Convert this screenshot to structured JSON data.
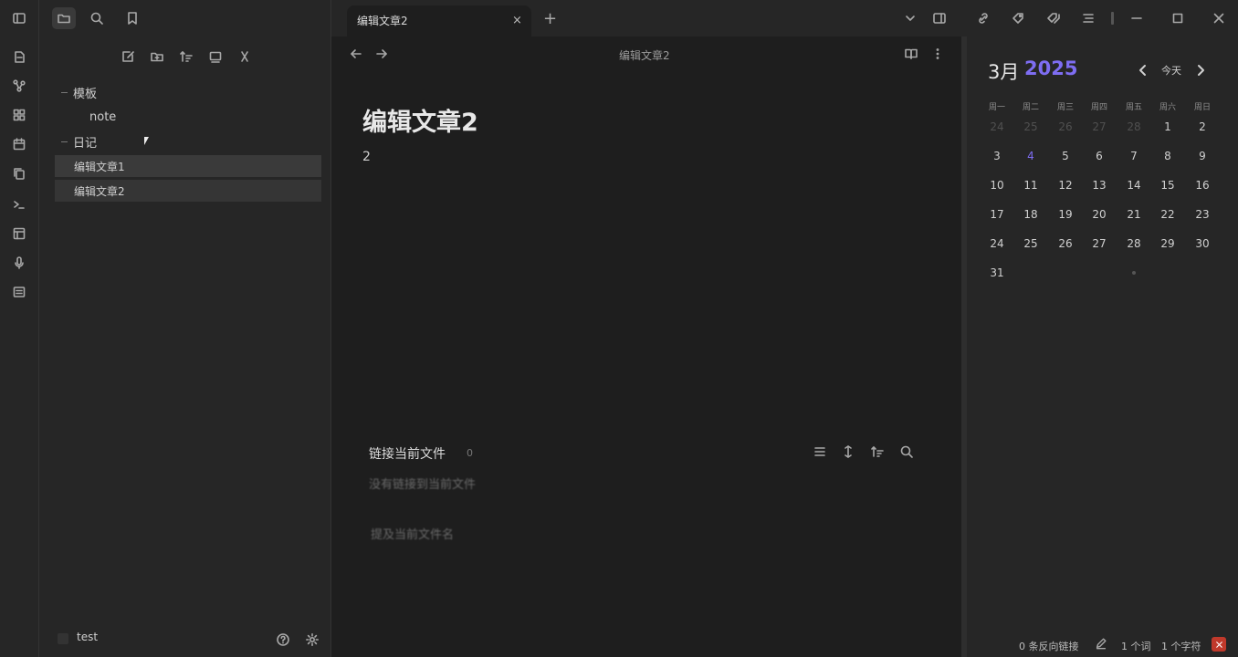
{
  "tab": {
    "title": "编辑文章2",
    "close": "×",
    "add": "+"
  },
  "file_explorer": {
    "folders": [
      {
        "name": "模板",
        "children": [
          "note"
        ]
      },
      {
        "name": "日记",
        "children": []
      }
    ],
    "files": [
      "编辑文章1",
      "编辑文章2"
    ]
  },
  "vault": {
    "name": "test"
  },
  "editor": {
    "breadcrumb": "编辑文章2",
    "title": "编辑文章2",
    "body": "2"
  },
  "backlinks": {
    "title": "链接当前文件",
    "count": "0",
    "linked_empty": "没有链接到当前文件",
    "unlinked": "提及当前文件名"
  },
  "calendar": {
    "month": "3月",
    "year": "2025",
    "today_label": "今天",
    "weekdays": [
      "周一",
      "周二",
      "周三",
      "周四",
      "周五",
      "周六",
      "周日"
    ],
    "weeks": [
      [
        "24",
        "25",
        "26",
        "27",
        "28",
        "1",
        "2"
      ],
      [
        "3",
        "4",
        "5",
        "6",
        "7",
        "8",
        "9"
      ],
      [
        "10",
        "11",
        "12",
        "13",
        "14",
        "15",
        "16"
      ],
      [
        "17",
        "18",
        "19",
        "20",
        "21",
        "22",
        "23"
      ],
      [
        "24",
        "25",
        "26",
        "27",
        "28",
        "29",
        "30"
      ],
      [
        "31",
        "",
        "",
        "",
        "",
        "",
        ""
      ]
    ],
    "today": "4",
    "accent_color": "#7e6df2"
  },
  "status_bar": {
    "backlinks": "0 条反向链接",
    "words": "1 个词",
    "chars": "1 个字符"
  }
}
